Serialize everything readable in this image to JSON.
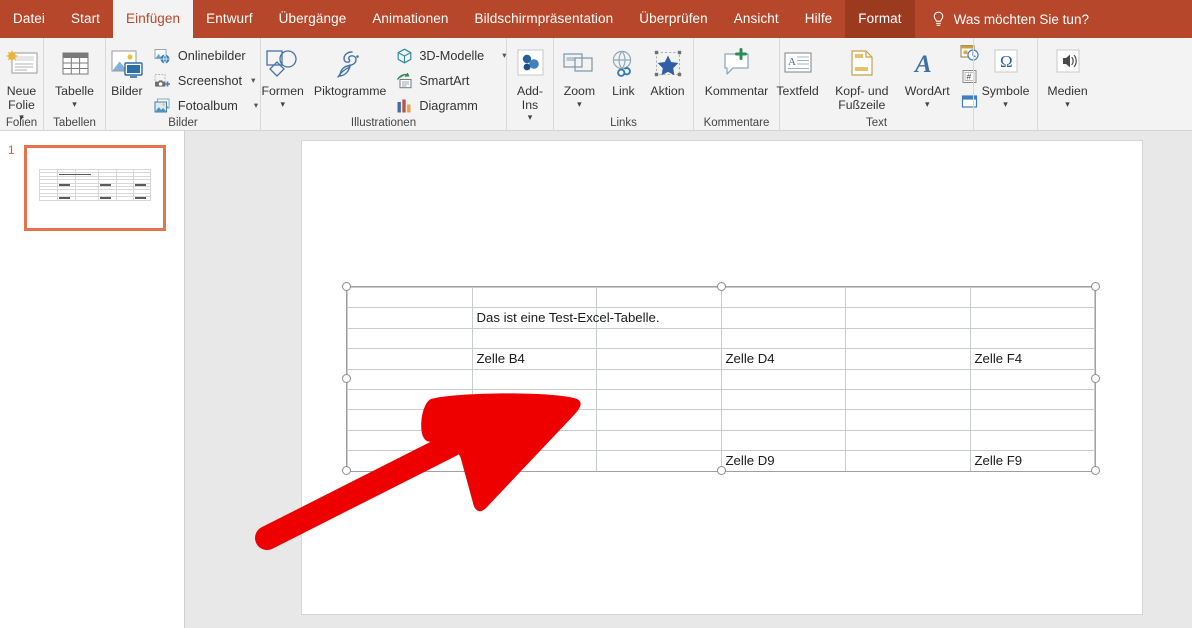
{
  "app": {
    "name": "Microsoft PowerPoint",
    "accent_color": "#B7472A",
    "contextual_tab_color": "#9C3A20",
    "annotation_color": "#EE0000"
  },
  "tabs": [
    {
      "label": "Datei",
      "state": "normal",
      "name": "tab-datei"
    },
    {
      "label": "Start",
      "state": "normal",
      "name": "tab-start"
    },
    {
      "label": "Einfügen",
      "state": "active",
      "name": "tab-einfuegen"
    },
    {
      "label": "Entwurf",
      "state": "normal",
      "name": "tab-entwurf"
    },
    {
      "label": "Übergänge",
      "state": "normal",
      "name": "tab-uebergaenge"
    },
    {
      "label": "Animationen",
      "state": "normal",
      "name": "tab-animationen"
    },
    {
      "label": "Bildschirmpräsentation",
      "state": "normal",
      "name": "tab-bildschirmpraesentation"
    },
    {
      "label": "Überprüfen",
      "state": "normal",
      "name": "tab-ueberpruefen"
    },
    {
      "label": "Ansicht",
      "state": "normal",
      "name": "tab-ansicht"
    },
    {
      "label": "Hilfe",
      "state": "normal",
      "name": "tab-hilfe"
    },
    {
      "label": "Format",
      "state": "contextual",
      "name": "tab-format"
    }
  ],
  "tell_me": {
    "label": "Was möchten Sie tun?",
    "icon": "lightbulb-icon"
  },
  "ribbon": {
    "groups": [
      {
        "label": "Folien",
        "buttons": [
          {
            "label": "Neue Folie",
            "icon": "new-slide-icon",
            "dropdown": true
          }
        ]
      },
      {
        "label": "Tabellen",
        "buttons": [
          {
            "label": "Tabelle",
            "icon": "table-icon",
            "dropdown": true
          }
        ]
      },
      {
        "label": "Bilder",
        "buttons": [
          {
            "label": "Bilder",
            "icon": "pictures-icon",
            "dropdown": false
          }
        ],
        "small_buttons": [
          {
            "label": "Onlinebilder",
            "icon": "online-pictures-icon",
            "dropdown": false
          },
          {
            "label": "Screenshot",
            "icon": "screenshot-icon",
            "dropdown": true
          },
          {
            "label": "Fotoalbum",
            "icon": "photo-album-icon",
            "dropdown": true
          }
        ]
      },
      {
        "label": "Illustrationen",
        "buttons": [
          {
            "label": "Formen",
            "icon": "shapes-icon",
            "dropdown": true
          },
          {
            "label": "Piktogramme",
            "icon": "icons-icon",
            "dropdown": false
          }
        ],
        "small_buttons": [
          {
            "label": "3D-Modelle",
            "icon": "3d-model-icon",
            "dropdown": true
          },
          {
            "label": "SmartArt",
            "icon": "smartart-icon",
            "dropdown": false
          },
          {
            "label": "Diagramm",
            "icon": "chart-icon",
            "dropdown": false
          }
        ]
      },
      {
        "label": "",
        "buttons": [
          {
            "label": "Add-Ins",
            "icon": "add-ins-icon",
            "dropdown": true,
            "wrap": true
          }
        ]
      },
      {
        "label": "Links",
        "buttons": [
          {
            "label": "Zoom",
            "icon": "zoom-icon",
            "dropdown": true
          },
          {
            "label": "Link",
            "icon": "link-icon",
            "dropdown": false
          },
          {
            "label": "Aktion",
            "icon": "action-icon",
            "dropdown": false
          }
        ]
      },
      {
        "label": "Kommentare",
        "buttons": [
          {
            "label": "Kommentar",
            "icon": "new-comment-icon",
            "dropdown": false
          }
        ]
      },
      {
        "label": "Text",
        "buttons": [
          {
            "label": "Textfeld",
            "icon": "text-box-icon",
            "dropdown": false
          },
          {
            "label": "Kopf- und Fußzeile",
            "icon": "header-footer-icon",
            "dropdown": false,
            "wrap": true
          },
          {
            "label": "WordArt",
            "icon": "wordart-icon",
            "dropdown": true
          }
        ],
        "tiny_buttons": [
          {
            "label": "Datum und Uhrzeit",
            "icon": "date-time-icon"
          },
          {
            "label": "Foliennummer",
            "icon": "slide-number-icon"
          },
          {
            "label": "Objekt",
            "icon": "object-icon"
          }
        ]
      },
      {
        "label": "",
        "buttons": [
          {
            "label": "Symbole",
            "icon": "symbol-icon",
            "dropdown": true
          }
        ]
      },
      {
        "label": "",
        "buttons": [
          {
            "label": "Medien",
            "icon": "media-icon",
            "dropdown": true
          }
        ]
      }
    ]
  },
  "slide_panel": {
    "slides": [
      {
        "number": "1",
        "selected": true
      }
    ]
  },
  "slide": {
    "selected_object": "excel-table-object",
    "table": {
      "rows": 9,
      "columns": 6,
      "cells": [
        [
          "",
          "",
          "",
          "",
          "",
          ""
        ],
        [
          "",
          "Das ist eine Test-Excel-Tabelle.",
          "",
          "",
          "",
          ""
        ],
        [
          "",
          "",
          "",
          "",
          "",
          ""
        ],
        [
          "",
          "Zelle B4",
          "",
          "Zelle D4",
          "",
          "Zelle F4"
        ],
        [
          "",
          "",
          "",
          "",
          "",
          ""
        ],
        [
          "",
          "",
          "",
          "",
          "",
          ""
        ],
        [
          "",
          "",
          "",
          "",
          "",
          ""
        ],
        [
          "",
          "",
          "",
          "",
          "",
          ""
        ],
        [
          "",
          "Zelle B9",
          "",
          "Zelle D9",
          "",
          "Zelle F9"
        ]
      ]
    },
    "annotation": {
      "type": "hand-drawn-arrow",
      "color": "#EE0000",
      "points_to": "table-lower-left"
    }
  }
}
